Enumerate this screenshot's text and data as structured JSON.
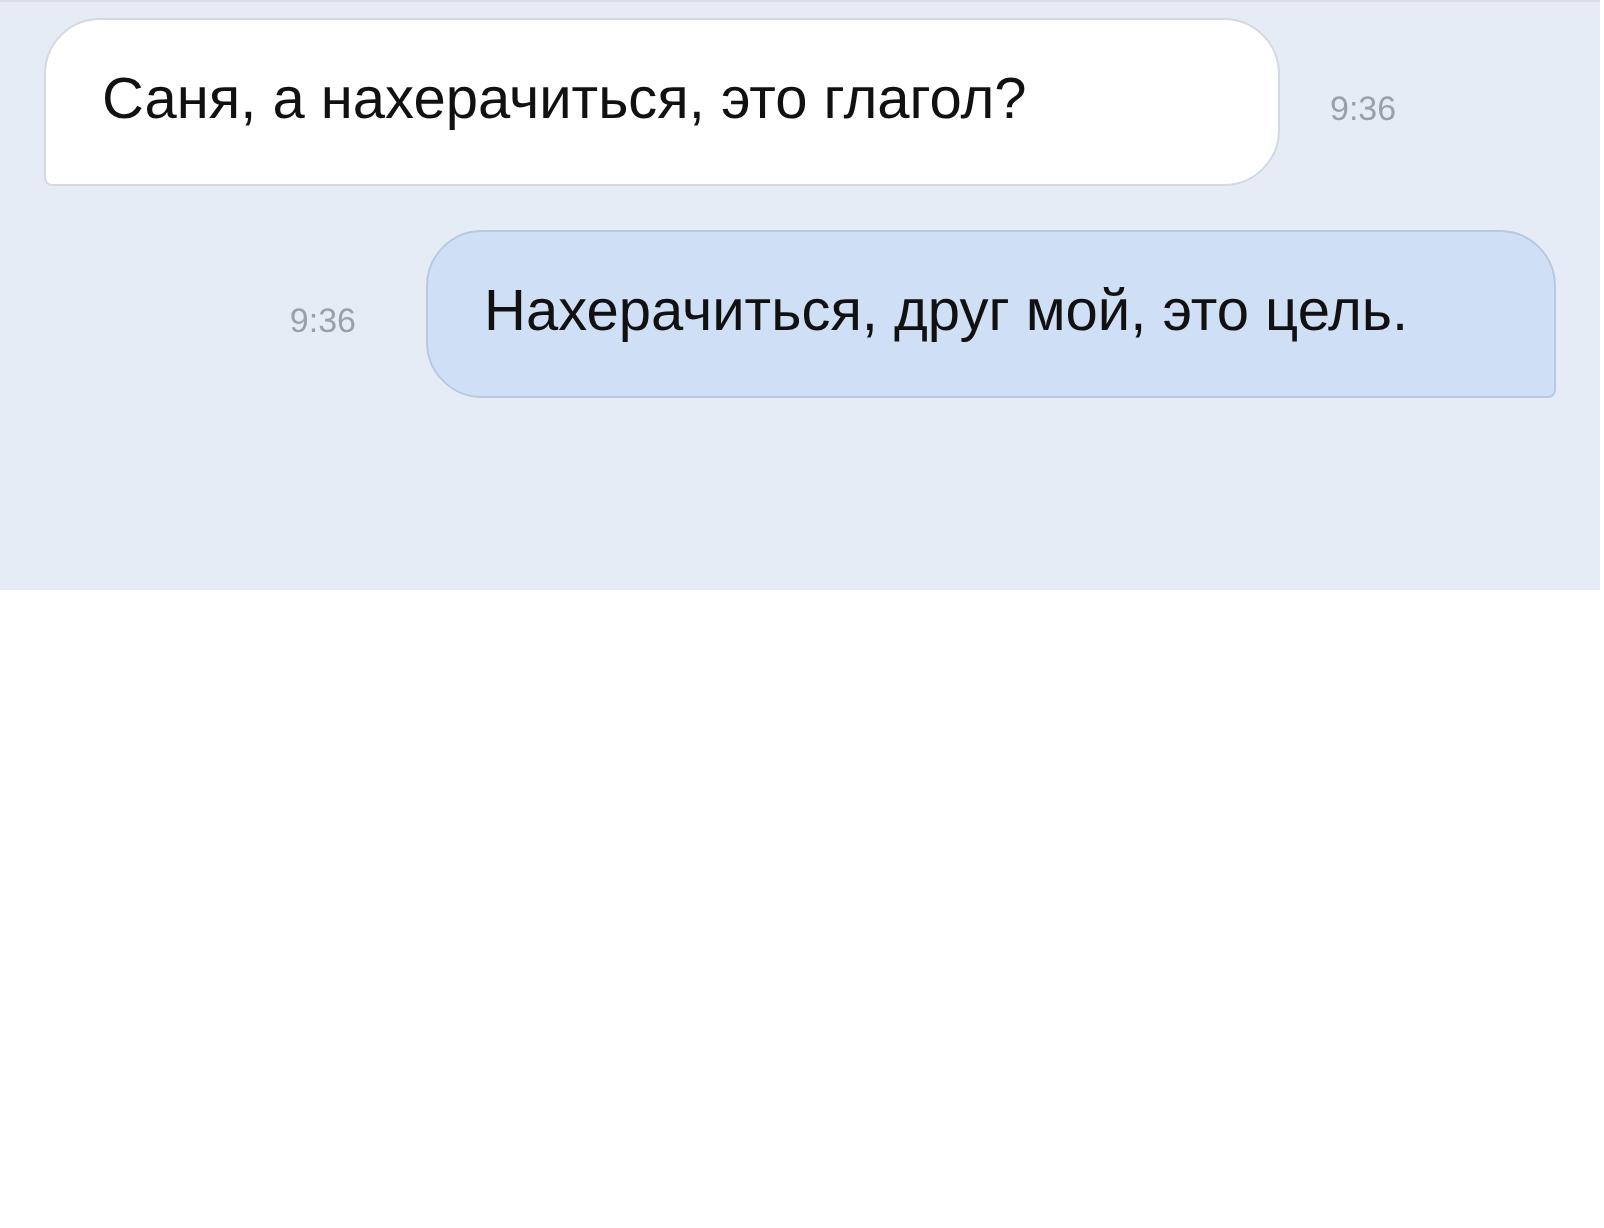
{
  "messages": [
    {
      "kind": "incoming",
      "text": "Саня, а нахерачиться, это глагол?",
      "time": "9:36"
    },
    {
      "kind": "outgoing",
      "text": "Нахерачиться, друг мой, это цель.",
      "time": "9:36"
    }
  ]
}
